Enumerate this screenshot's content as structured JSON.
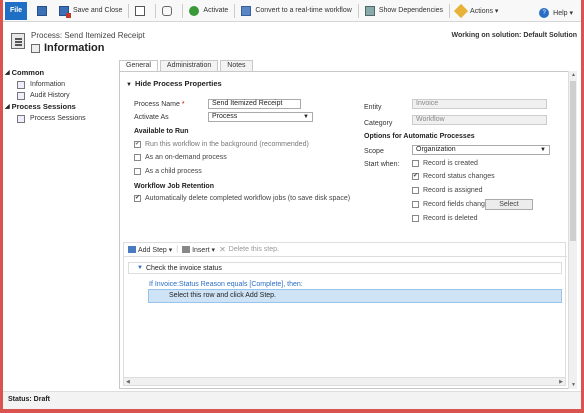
{
  "ribbon": {
    "file": "File",
    "save_close": "Save and Close",
    "activate": "Activate",
    "convert": "Convert to a real-time workflow",
    "deps": "Show Dependencies",
    "actions": "Actions ▾",
    "help": "Help ▾"
  },
  "header": {
    "subtitle": "Process: Send Itemized Receipt",
    "title": "Information",
    "solution": "Working on solution: Default Solution"
  },
  "nav": {
    "common": "Common",
    "items_common": [
      "Information",
      "Audit History"
    ],
    "process_sessions": "Process Sessions",
    "items_sessions": [
      "Process Sessions"
    ]
  },
  "tabs": [
    "General",
    "Administration",
    "Notes"
  ],
  "form": {
    "section_title": "Hide Process Properties",
    "process_name_label": "Process Name",
    "process_name_value": "Send Itemized Receipt",
    "activate_as_label": "Activate As",
    "activate_as_value": "Process",
    "available_to_run": "Available to Run",
    "cb_background": "Run this workflow in the background (recommended)",
    "cb_ondemand": "As an on-demand process",
    "cb_child": "As a child process",
    "retention_title": "Workflow Job Retention",
    "cb_autodelete": "Automatically delete completed workflow jobs (to save disk space)",
    "entity_label": "Entity",
    "entity_value": "Invoice",
    "category_label": "Category",
    "category_value": "Workflow",
    "options_title": "Options for Automatic Processes",
    "scope_label": "Scope",
    "scope_value": "Organization",
    "start_when_label": "Start when:",
    "cb_created": "Record is created",
    "cb_status": "Record status changes",
    "cb_assigned": "Record is assigned",
    "cb_fields": "Record fields change",
    "select_btn": "Select",
    "cb_deleted": "Record is deleted"
  },
  "designer": {
    "add_step": "Add Step ▾",
    "insert": "Insert ▾",
    "delete": "Delete this step.",
    "step_title": "Check the invoice status",
    "condition": "If Invoice:Status Reason equals [Complete], then:",
    "row_hint": "Select this row and click Add Step."
  },
  "status": "Status: Draft"
}
